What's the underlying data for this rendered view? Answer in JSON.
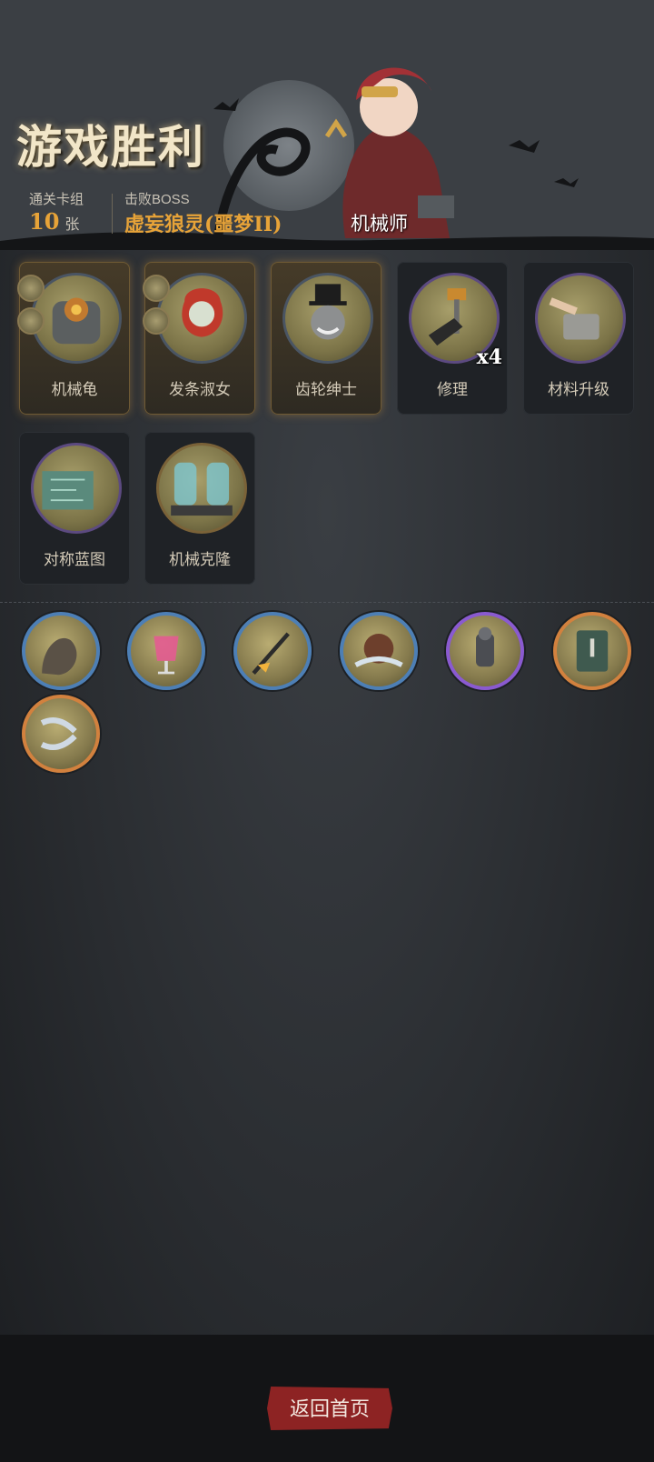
{
  "banner": {
    "title": "游戏胜利",
    "hero_name": "机械师",
    "stats": {
      "deck_label": "通关卡组",
      "deck_count": "10",
      "deck_unit": "张",
      "boss_label": "击败BOSS",
      "boss_name": "虚妄狼灵(噩梦II)"
    }
  },
  "cards": [
    {
      "name": "机械龟",
      "rarity": "gold",
      "icon": "mech-turtle-icon"
    },
    {
      "name": "发条淑女",
      "rarity": "gold",
      "icon": "clockwork-lady-icon"
    },
    {
      "name": "齿轮绅士",
      "rarity": "gold",
      "icon": "gear-gentleman-icon"
    },
    {
      "name": "修理",
      "rarity": "normal",
      "icon": "repair-icon",
      "count": "x4"
    },
    {
      "name": "材料升级",
      "rarity": "normal",
      "icon": "material-upgrade-icon"
    },
    {
      "name": "对称蓝图",
      "rarity": "normal",
      "icon": "blueprint-icon"
    },
    {
      "name": "机械克隆",
      "rarity": "normal",
      "icon": "mech-clone-icon"
    }
  ],
  "relics": [
    {
      "icon": "hooded-rider-icon",
      "rim": "blue"
    },
    {
      "icon": "cocktail-icon",
      "rim": "blue"
    },
    {
      "icon": "flaming-arrow-icon",
      "rim": "blue"
    },
    {
      "icon": "beast-icon",
      "rim": "blue"
    },
    {
      "icon": "armored-knight-icon",
      "rim": "purple"
    },
    {
      "icon": "spellbook-icon",
      "rim": "orange"
    },
    {
      "icon": "shuriken-icon",
      "rim": "orange"
    }
  ],
  "footer": {
    "home_button": "返回首页"
  },
  "colors": {
    "accent_gold": "#e7a338",
    "button_red": "#8d2323",
    "rim_blue": "#4d7fb5",
    "rim_purple": "#8a5ad0",
    "rim_orange": "#d2813e"
  }
}
